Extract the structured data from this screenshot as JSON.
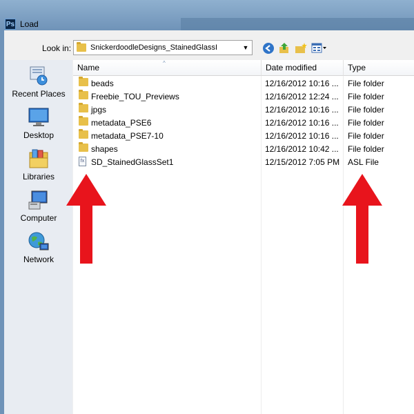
{
  "window": {
    "title": "Load",
    "app_icon_text": "Ps"
  },
  "toolbar": {
    "lookin_label": "Look in:",
    "lookin_value": "SnickerdoodleDesigns_StainedGlassI"
  },
  "places": [
    {
      "label": "Recent Places",
      "icon": "recent-places-icon"
    },
    {
      "label": "Desktop",
      "icon": "desktop-icon"
    },
    {
      "label": "Libraries",
      "icon": "libraries-icon"
    },
    {
      "label": "Computer",
      "icon": "computer-icon"
    },
    {
      "label": "Network",
      "icon": "network-icon"
    }
  ],
  "columns": {
    "name": "Name",
    "date": "Date modified",
    "type": "Type"
  },
  "files": [
    {
      "name": "beads",
      "date": "12/16/2012 10:16 ...",
      "type": "File folder",
      "kind": "folder"
    },
    {
      "name": "Freebie_TOU_Previews",
      "date": "12/16/2012 12:24 ...",
      "type": "File folder",
      "kind": "folder"
    },
    {
      "name": "jpgs",
      "date": "12/16/2012 10:16 ...",
      "type": "File folder",
      "kind": "folder"
    },
    {
      "name": "metadata_PSE6",
      "date": "12/16/2012 10:16 ...",
      "type": "File folder",
      "kind": "folder"
    },
    {
      "name": "metadata_PSE7-10",
      "date": "12/16/2012 10:16 ...",
      "type": "File folder",
      "kind": "folder"
    },
    {
      "name": "shapes",
      "date": "12/16/2012 10:42 ...",
      "type": "File folder",
      "kind": "folder"
    },
    {
      "name": "SD_StainedGlassSet1",
      "date": "12/15/2012 7:05 PM",
      "type": "ASL File",
      "kind": "asl"
    }
  ],
  "colors": {
    "annotation_arrow": "#e8141c",
    "folder": "#e8c04a",
    "title_bar": "#7fa3c8"
  }
}
